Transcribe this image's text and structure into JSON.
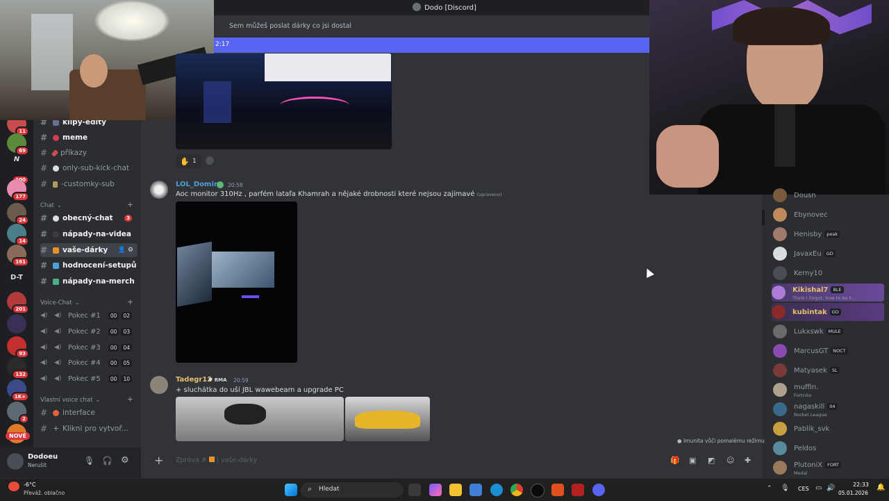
{
  "window": {
    "title": "Dodo [Discord]"
  },
  "channel": {
    "topic": "Sem můžeš poslat dárky co jsi dostal",
    "new_bar_time": "2:17"
  },
  "servers": [
    {
      "badge": "11"
    },
    {
      "badge": "69"
    },
    {
      "badge": "100"
    },
    {
      "badge": "177"
    },
    {
      "badge": "24"
    },
    {
      "badge": "14"
    },
    {
      "badge": "161"
    },
    {
      "text": "D-T"
    },
    {
      "badge": "201"
    },
    {
      "badge": ""
    },
    {
      "badge": "93"
    },
    {
      "badge": "132"
    },
    {
      "badge": "1K+"
    },
    {
      "badge": "2"
    }
  ],
  "server_new": "NOVÉ",
  "channels_top": [
    {
      "name": "klipy-edity",
      "bright": true
    },
    {
      "name": "meme",
      "bright": true
    },
    {
      "name": "příkazy",
      "bright": false
    },
    {
      "name": "only-sub-kick-chat",
      "bright": false
    },
    {
      "name": "-customky-sub",
      "bright": false
    }
  ],
  "category_chat": "Chat",
  "channels_chat": [
    {
      "name": "obecný-chat",
      "bright": true,
      "count": "3"
    },
    {
      "name": "nápady-na-videa",
      "bright": true
    },
    {
      "name": "vaše-dárky",
      "bright": true,
      "selected": true
    },
    {
      "name": "hodnocení-setupů",
      "bright": true
    },
    {
      "name": "nápady-na-merch",
      "bright": true
    }
  ],
  "category_voice": "Voice-Chat",
  "voice_channels": [
    {
      "name": "Pokec #1",
      "m": "00",
      "s": "02"
    },
    {
      "name": "Pokec #2",
      "m": "00",
      "s": "03"
    },
    {
      "name": "Pokec #3",
      "m": "00",
      "s": "04"
    },
    {
      "name": "Pokec #4",
      "m": "00",
      "s": "05"
    },
    {
      "name": "Pokec #5",
      "m": "00",
      "s": "10"
    }
  ],
  "category_custom": "Vlastní voice chat",
  "custom_channels": [
    {
      "name": "interface"
    },
    {
      "name": "Klikni pro vytvoř..."
    }
  ],
  "user": {
    "name": "Dodoeu",
    "status": "Nerušit"
  },
  "reactions": {
    "count": "1"
  },
  "messages": [
    {
      "author": "LOL_Domin",
      "time": "20:58",
      "text": "Aoc monitor 310Hz , parfém latafa Khamrah a nějaké drobnosti které nejsou zajímavé",
      "edited": "(upraveno)"
    },
    {
      "author": "Tadegr12",
      "tag": "RMA",
      "time": "20:59",
      "text": "+ sluchátka do uší JBL wawebeam a upgrade PC"
    }
  ],
  "members": [
    {
      "name": "Dousn",
      "tag": ""
    },
    {
      "name": "Ebynovec",
      "tag": ""
    },
    {
      "name": "Henisby",
      "tag": "peak"
    },
    {
      "name": "JavaxEu",
      "tag": "GD"
    },
    {
      "name": "Kerny10",
      "tag": ""
    },
    {
      "name": "Kikishal7",
      "tag": "BLE",
      "sub": "Think i forgot, how to be h...",
      "highlight": true
    },
    {
      "name": "kubintak",
      "tag": "GD",
      "highlight": true
    },
    {
      "name": "Lukxswk",
      "tag": "MULE"
    },
    {
      "name": "MarcusGT",
      "tag": "NOCT"
    },
    {
      "name": "Matyasek",
      "tag": "SL"
    },
    {
      "name": "muffin.",
      "tag": "",
      "sub": "Fortnite"
    },
    {
      "name": "nagaskill",
      "tag": "04",
      "sub": "Rocket League"
    },
    {
      "name": "Pablik_svk",
      "tag": ""
    },
    {
      "name": "Peldos",
      "tag": ""
    },
    {
      "name": "PlutoniX",
      "tag": "FORT",
      "sub": "Medal"
    }
  ],
  "immunity": "Imunita vůči pomalému režimu",
  "composer": {
    "placeholder": "Zpráva #",
    "channel": "vaše-dárky"
  },
  "taskbar": {
    "weather_temp": "-6°C",
    "weather_desc": "Převáž. oblačno",
    "search": "Hledat",
    "lang": "CES",
    "time": "22:33",
    "date": "05.01.2026"
  },
  "colors": {
    "accent": "#5865f2",
    "red": "#da373c",
    "bg": "#313338"
  }
}
